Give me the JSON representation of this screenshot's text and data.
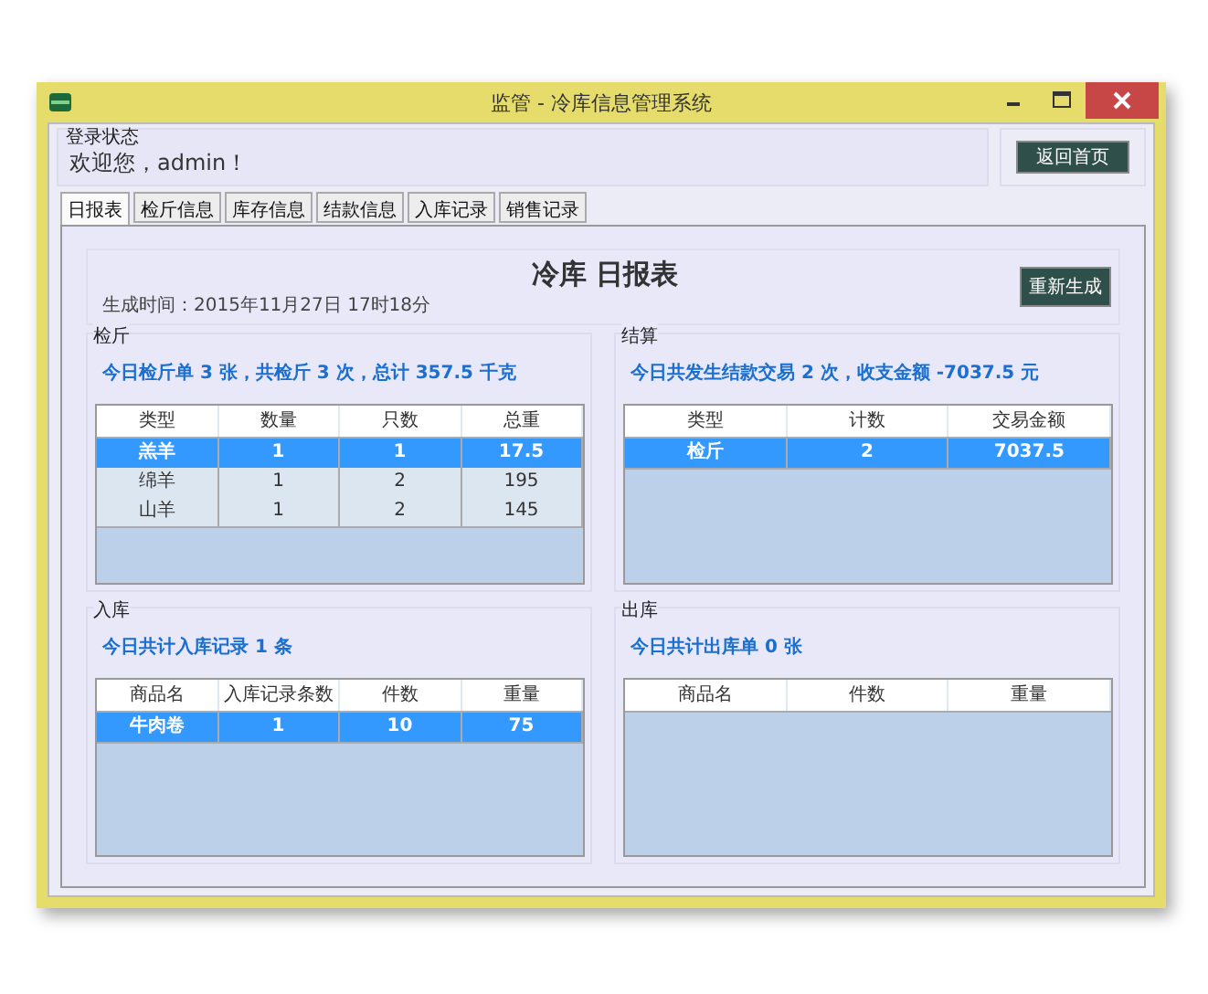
{
  "window": {
    "title": "监管 - 冷库信息管理系统"
  },
  "login_group": {
    "label": "登录状态",
    "welcome": "欢迎您，admin！"
  },
  "home_button": "返回首页",
  "tabs": [
    {
      "label": "日报表",
      "selected": true
    },
    {
      "label": "检斤信息",
      "selected": false
    },
    {
      "label": "库存信息",
      "selected": false
    },
    {
      "label": "结款信息",
      "selected": false
    },
    {
      "label": "入库记录",
      "selected": false
    },
    {
      "label": "销售记录",
      "selected": false
    }
  ],
  "report": {
    "title": "冷库 日报表",
    "generated": "生成时间：2015年11月27日 17时18分",
    "regenerate_button": "重新生成"
  },
  "sections": [
    {
      "title": "检斤",
      "summary": "今日检斤单 3 张，共检斤 3 次，总计 357.5 千克",
      "columns": [
        "类型",
        "数量",
        "只数",
        "总重"
      ],
      "rows": [
        {
          "cells": [
            "羔羊",
            "1",
            "1",
            "17.5"
          ],
          "selected": true
        },
        {
          "cells": [
            "绵羊",
            "1",
            "2",
            "195"
          ],
          "selected": false
        },
        {
          "cells": [
            "山羊",
            "1",
            "2",
            "145"
          ],
          "selected": false
        }
      ]
    },
    {
      "title": "结算",
      "summary": "今日共发生结款交易 2 次，收支金额 -7037.5 元",
      "columns": [
        "类型",
        "计数",
        "交易金额"
      ],
      "rows": [
        {
          "cells": [
            "检斤",
            "2",
            "7037.5"
          ],
          "selected": true
        }
      ]
    },
    {
      "title": "入库",
      "summary": "今日共计入库记录 1 条",
      "columns": [
        "商品名",
        "入库记录条数",
        "件数",
        "重量"
      ],
      "rows": [
        {
          "cells": [
            "牛肉卷",
            "1",
            "10",
            "75"
          ],
          "selected": true
        }
      ]
    },
    {
      "title": "出库",
      "summary": "今日共计出库单 0 张",
      "columns": [
        "商品名",
        "件数",
        "重量"
      ]
    }
  ]
}
